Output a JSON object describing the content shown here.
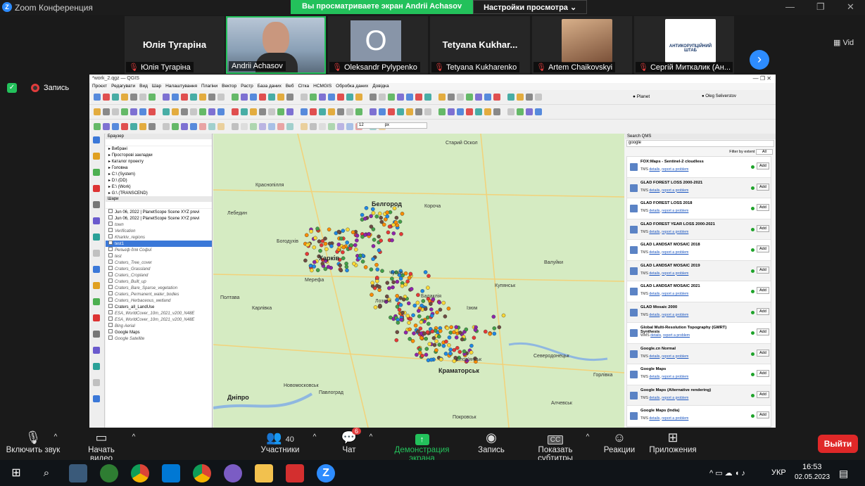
{
  "zoom": {
    "window_title": "Zoom Конференция",
    "share_banner": "Вы просматриваете экран Andrii Achasov",
    "view_settings": "Настройки просмотра",
    "view_label": "Vid",
    "participants_tiles": [
      {
        "big": "Юлія Тугаріна",
        "name": "Юлія Тугаріна"
      },
      {
        "big": "",
        "name": "Andrii Achasov"
      },
      {
        "big": "O",
        "name": "Oleksandr Pylypenko"
      },
      {
        "big": "Tetyana  Kukhar...",
        "name": "Tetyana Kukharenko"
      },
      {
        "big": "",
        "name": "Artem Chaikovskyi"
      },
      {
        "big": "АНТИКОРУПЦІЙНИЙ ШТАБ",
        "name": "Сергій Миткалик (Ан..."
      }
    ],
    "recording": "Запись",
    "bottom": {
      "mic": "Включить звук",
      "video": "Начать видео",
      "participants": "Участники",
      "participants_count": "40",
      "chat": "Чат",
      "chat_badge": "6",
      "share": "Демонстрация экрана",
      "record": "Запись",
      "subtitles": "Показать субтитры",
      "subtitles_icon": "CC",
      "reactions": "Реакции",
      "apps": "Приложения",
      "leave": "Выйти"
    }
  },
  "qgis": {
    "title": "*work_2.qgz — QGIS",
    "menu": [
      "Проєкт",
      "Редагувати",
      "Вид",
      "Шар",
      "Налаштування",
      "Плагіни",
      "Вектор",
      "Растр",
      "База даних",
      "Веб",
      "Сітка",
      "HCMGIS",
      "Обробка даних",
      "Довідка"
    ],
    "top_right": {
      "planet": "Planet",
      "user": "Oleg Seliverstov"
    },
    "browser_title": "Браузер",
    "browser_items": [
      "Вибрані",
      "Просторові закладки",
      "Каталог проекту",
      "Головна",
      "C:\\ (System)",
      "D:\\ (DD)",
      "E:\\ (Work)",
      "G:\\ (TRANSCEND)"
    ],
    "layers_title": "Шари",
    "layers": [
      {
        "t": "Jun 06, 2022 | PlanetScope Scene XYZ previ",
        "cls": ""
      },
      {
        "t": "Jun 06, 2022 | PlanetScope Scene XYZ previ",
        "cls": ""
      },
      {
        "t": "town",
        "cls": "it"
      },
      {
        "t": "Verification",
        "cls": "it"
      },
      {
        "t": "Kharkiv_regions",
        "cls": "it"
      },
      {
        "t": "test1",
        "cls": "sel"
      },
      {
        "t": "Рельєф для Софиї",
        "cls": "it"
      },
      {
        "t": "test",
        "cls": "it"
      },
      {
        "t": "Craters_Tree_cover",
        "cls": "it"
      },
      {
        "t": "Craters_Grassland",
        "cls": "it"
      },
      {
        "t": "Craters_Cropland",
        "cls": "it"
      },
      {
        "t": "Craters_Built_up",
        "cls": "it"
      },
      {
        "t": "Craters_Bare_Sparse_vegetation",
        "cls": "it"
      },
      {
        "t": "Craters_Permanent_water_bodies",
        "cls": "it"
      },
      {
        "t": "Craters_Herbaceous_wetland",
        "cls": "it"
      },
      {
        "t": "Craters_all_LandUse",
        "cls": ""
      },
      {
        "t": "ESA_WorldCover_10m_2021_v200_N48E",
        "cls": "it"
      },
      {
        "t": "ESA_WorldCover_10m_2021_v200_N48E",
        "cls": "it"
      },
      {
        "t": "Bing Aerial",
        "cls": "it"
      },
      {
        "t": "Google Maps",
        "cls": ""
      },
      {
        "t": "Google Satellite",
        "cls": "it"
      }
    ],
    "scale_value": "12",
    "scale_unit": "px",
    "qms_title": "Search QMS",
    "qms_search": "google",
    "qms_filter": "Filter by extent",
    "qms_filter_value": "All",
    "qms_add": "Add",
    "qms_details": "details",
    "qms_report": "report a problem",
    "qms_items": [
      {
        "t": "FOX:Maps - Sentinel-2 cloudless",
        "type": "TMS"
      },
      {
        "t": "GLAD FOREST LOSS 2000-2021",
        "type": "TMS"
      },
      {
        "t": "GLAD FOREST LOSS 2018",
        "type": "TMS"
      },
      {
        "t": "GLAD FOREST YEAR LOSS 2000-2021",
        "type": "TMS"
      },
      {
        "t": "GLAD LANDSAT MOSAIC 2018",
        "type": "TMS"
      },
      {
        "t": "GLAD LANDSAT MOSAIC 2019",
        "type": "TMS"
      },
      {
        "t": "GLAD LANDSAT MOSAIC 2021",
        "type": "TMS"
      },
      {
        "t": "GLAD Mosaic 2000",
        "type": "TMS"
      },
      {
        "t": "Global Multi-Resolution Topography (GMRT) Synthesis",
        "type": "WMS"
      },
      {
        "t": "Google.cn Normal",
        "type": "TMS"
      },
      {
        "t": "Google Maps",
        "type": "TMS"
      },
      {
        "t": "Google Maps (Alternative rendering)",
        "type": "TMS"
      },
      {
        "t": "Google Maps (India)",
        "type": "TMS"
      }
    ],
    "map_labels": [
      {
        "t": "Белгород",
        "c": "city"
      },
      {
        "t": "Харків",
        "c": "city"
      },
      {
        "t": "Краматорськ",
        "c": "city"
      },
      {
        "t": "Слов'янськ",
        "c": ""
      },
      {
        "t": "Северодонецьк",
        "c": ""
      },
      {
        "t": "Алчевськ",
        "c": ""
      },
      {
        "t": "Павлоград",
        "c": ""
      },
      {
        "t": "Дніпро",
        "c": "city"
      },
      {
        "t": "Купянськ",
        "c": ""
      },
      {
        "t": "Старий Оскол",
        "c": ""
      },
      {
        "t": "Короча",
        "c": ""
      },
      {
        "t": "Валуйки",
        "c": ""
      },
      {
        "t": "Краснопілля",
        "c": ""
      },
      {
        "t": "Лебедин",
        "c": ""
      },
      {
        "t": "Богодухів",
        "c": ""
      },
      {
        "t": "Полтава",
        "c": ""
      },
      {
        "t": "Лозова",
        "c": ""
      },
      {
        "t": "Ізюм",
        "c": ""
      },
      {
        "t": "Балаклія",
        "c": ""
      },
      {
        "t": "Чугуїв",
        "c": ""
      },
      {
        "t": "Мерефа",
        "c": ""
      },
      {
        "t": "Карлівка",
        "c": ""
      },
      {
        "t": "Новомосковськ",
        "c": ""
      },
      {
        "t": "Горлівка",
        "c": ""
      },
      {
        "t": "Покровськ",
        "c": ""
      }
    ]
  },
  "taskbar": {
    "lang": "УКР",
    "time": "16:53",
    "date": "02.05.2023",
    "notif_count": "1"
  }
}
